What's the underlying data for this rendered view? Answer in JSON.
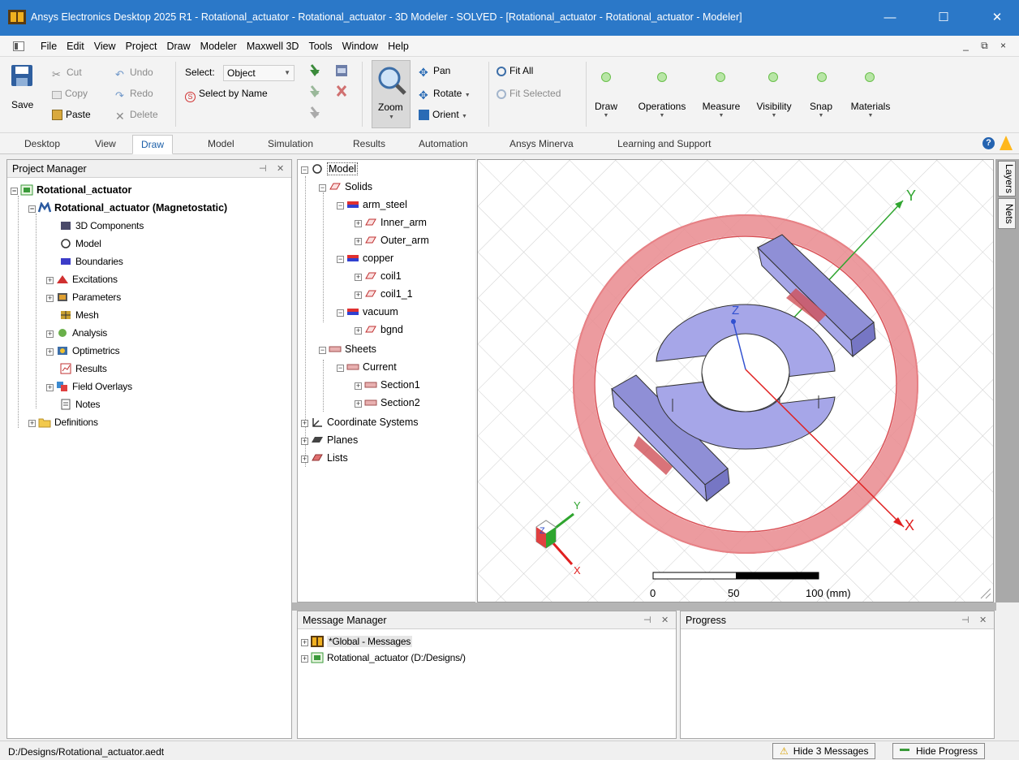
{
  "window": {
    "title": "Ansys Electronics Desktop 2025 R1 - Rotational_actuator - Rotational_actuator - 3D Modeler - SOLVED - [Rotational_actuator - Rotational_actuator - Modeler]",
    "minimize": "—",
    "maximize": "☐",
    "close": "✕"
  },
  "menu": [
    "File",
    "Edit",
    "View",
    "Project",
    "Draw",
    "Modeler",
    "Maxwell 3D",
    "Tools",
    "Window",
    "Help"
  ],
  "mdi_controls": "_ ⧉ ×",
  "ribbon": {
    "save": "Save",
    "cut": "Cut",
    "copy": "Copy",
    "paste": "Paste",
    "undo": "Undo",
    "redo": "Redo",
    "delete": "Delete",
    "select_label": "Select:",
    "select_value": "Object",
    "select_by_name": "Select by Name",
    "zoom": "Zoom",
    "pan": "Pan",
    "rotate": "Rotate",
    "orient": "Orient",
    "fit_all": "Fit All",
    "fit_selected": "Fit Selected",
    "groups": [
      "Draw",
      "Operations",
      "Measure",
      "Visibility",
      "Snap",
      "Materials"
    ]
  },
  "tabs": [
    "Desktop",
    "View",
    "Draw",
    "Model",
    "Simulation",
    "Results",
    "Automation",
    "Ansys Minerva",
    "Learning and Support"
  ],
  "active_tab": "Draw",
  "project_manager": {
    "title": "Project Manager",
    "items": [
      "Rotational_actuator",
      "Rotational_actuator (Magnetostatic)",
      "3D Components",
      "Model",
      "Boundaries",
      "Excitations",
      "Parameters",
      "Mesh",
      "Analysis",
      "Optimetrics",
      "Results",
      "Field Overlays",
      "Notes",
      "Definitions"
    ]
  },
  "model_tree": {
    "items": [
      "Model",
      "Solids",
      "arm_steel",
      "Inner_arm",
      "Outer_arm",
      "copper",
      "coil1",
      "coil1_1",
      "vacuum",
      "bgnd",
      "Sheets",
      "Current",
      "Section1",
      "Section2",
      "Coordinate Systems",
      "Planes",
      "Lists"
    ]
  },
  "viewport": {
    "axes": {
      "x": "X",
      "y": "Y",
      "z": "Z"
    },
    "scale_labels": [
      "0",
      "50",
      "100 (mm)"
    ]
  },
  "side_tabs": [
    "Layers",
    "Nets"
  ],
  "message_manager": {
    "title": "Message Manager",
    "items": [
      "*Global - Messages",
      "Rotational_actuator (D:/Designs/)"
    ]
  },
  "progress": {
    "title": "Progress"
  },
  "status": {
    "path": "D:/Designs/Rotational_actuator.aedt",
    "hide_messages": "Hide 3 Messages",
    "hide_progress": "Hide Progress"
  },
  "colors": {
    "titlebar": "#2b78c8",
    "coil": "#e8757a",
    "steel": "#a9a9e6"
  }
}
